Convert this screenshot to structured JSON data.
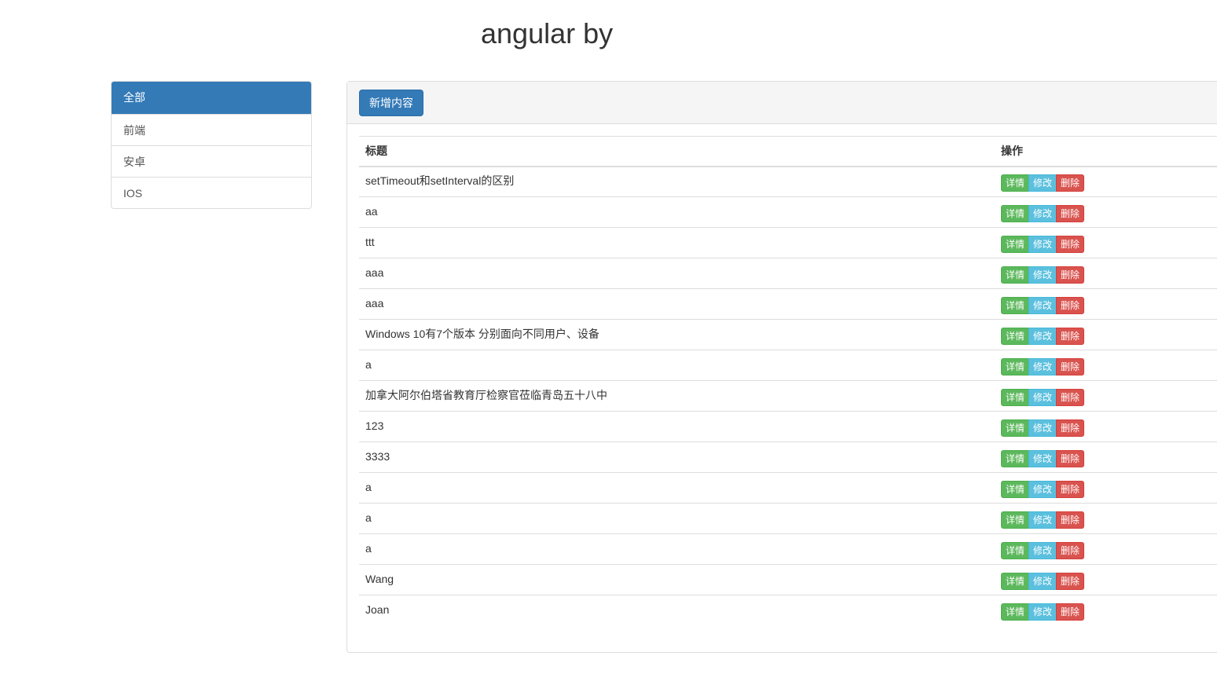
{
  "header": {
    "title": "angular by"
  },
  "sidebar": {
    "items": [
      {
        "label": "全部",
        "active": true
      },
      {
        "label": "前端",
        "active": false
      },
      {
        "label": "安卓",
        "active": false
      },
      {
        "label": "IOS",
        "active": false
      }
    ]
  },
  "toolbar": {
    "add_label": "新增内容"
  },
  "table": {
    "columns": [
      "标题",
      "操作"
    ],
    "actions": {
      "detail": "详情",
      "edit": "修改",
      "delete": "删除"
    },
    "rows": [
      "setTimeout和setInterval的区别",
      "aa",
      "ttt",
      "aaa",
      "aaa",
      "Windows 10有7个版本 分别面向不同用户、设备",
      "a",
      "加拿大阿尔伯塔省教育厅检察官莅临青岛五十八中",
      "123",
      "3333",
      "a",
      "a",
      "a",
      "Wang",
      "Joan"
    ]
  },
  "colors": {
    "primary": "#337ab7",
    "success": "#5cb85c",
    "info": "#5bc0de",
    "danger": "#d9534f"
  }
}
